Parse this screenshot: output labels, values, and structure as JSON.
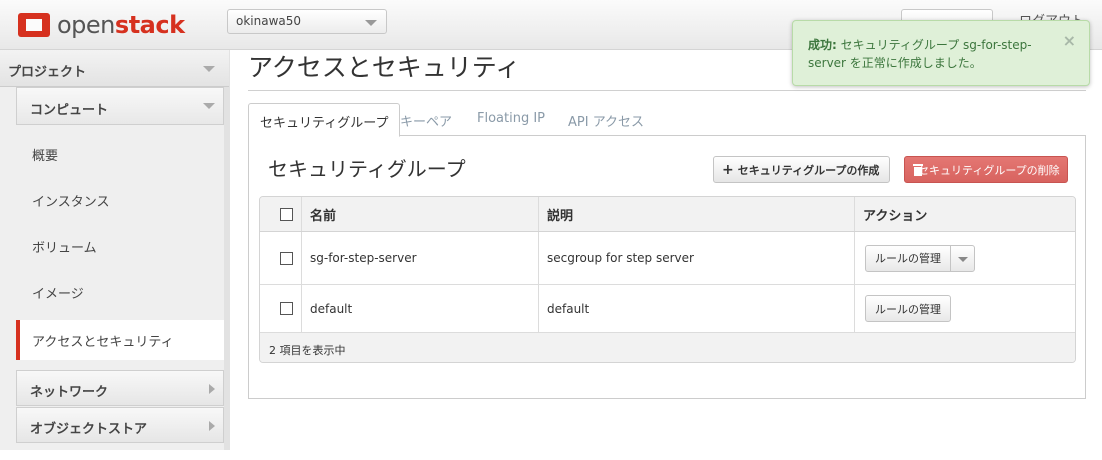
{
  "header": {
    "logo_open": "open",
    "logo_stack": "stack",
    "project": "okinawa50",
    "logout": "ログアウト"
  },
  "sidebar": {
    "project_label": "プロジェクト",
    "compute_label": "コンピュート",
    "items": [
      {
        "label": "概要"
      },
      {
        "label": "インスタンス"
      },
      {
        "label": "ボリューム"
      },
      {
        "label": "イメージ"
      },
      {
        "label": "アクセスとセキュリティ"
      }
    ],
    "network_label": "ネットワーク",
    "object_store_label": "オブジェクトストア"
  },
  "main": {
    "page_title": "アクセスとセキュリティ",
    "tabs": [
      {
        "label": "セキュリティグループ"
      },
      {
        "label": "キーペア"
      },
      {
        "label": "Floating IP"
      },
      {
        "label": "API アクセス"
      }
    ],
    "section_title": "セキュリティグループ",
    "create_button": "セキュリティグループの作成",
    "delete_button": "セキュリティグループの削除",
    "table": {
      "columns": [
        "名前",
        "説明",
        "アクション"
      ],
      "rows": [
        {
          "name": "sg-for-step-server",
          "description": "secgroup for step server",
          "action": "ルールの管理"
        },
        {
          "name": "default",
          "description": "default",
          "action": "ルールの管理"
        }
      ],
      "footer": "2 項目を表示中"
    }
  },
  "alert": {
    "prefix": "成功:",
    "message": "セキュリティグループ sg-for-step-server を正常に作成しました。",
    "close": "×"
  },
  "colors": {
    "brand_red": "#d6311f",
    "danger": "#d8635f",
    "success_bg": "#dff0d8",
    "success_text": "#3c763d"
  }
}
